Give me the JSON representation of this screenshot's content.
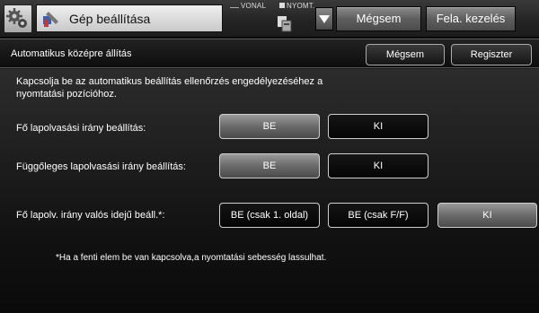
{
  "topbar": {
    "title": "Gép beállítása",
    "status_line": "VONAL",
    "status_print": "NYOMT.",
    "cancel_label": "Mégsem",
    "task_label": "Fela. kezelés"
  },
  "subheader": {
    "title": "Automatikus középre állítás",
    "cancel_label": "Mégsem",
    "register_label": "Regiszter"
  },
  "content": {
    "description": "Kapcsolja be az automatikus beállítás ellenőrzés engedélyezéséhez a nyomtatási pozícióhoz.",
    "rows": [
      {
        "label": "Fő lapolvasási irány beállítás:",
        "options": [
          {
            "label": "BE",
            "selected": true
          },
          {
            "label": "KI",
            "selected": false
          }
        ]
      },
      {
        "label": "Függőleges lapolvasási irány beállítás:",
        "options": [
          {
            "label": "BE",
            "selected": true
          },
          {
            "label": "KI",
            "selected": false
          }
        ]
      },
      {
        "label": "Fő lapolv. irány valós idejű beáll.*:",
        "options": [
          {
            "label": "BE (csak 1. oldal)",
            "selected": false
          },
          {
            "label": "BE (csak F/F)",
            "selected": false
          },
          {
            "label": "KI",
            "selected": true
          }
        ]
      }
    ],
    "note": "*Ha a fenti elem be van kapcsolva,a nyomtatási sebesség lassulhat."
  }
}
